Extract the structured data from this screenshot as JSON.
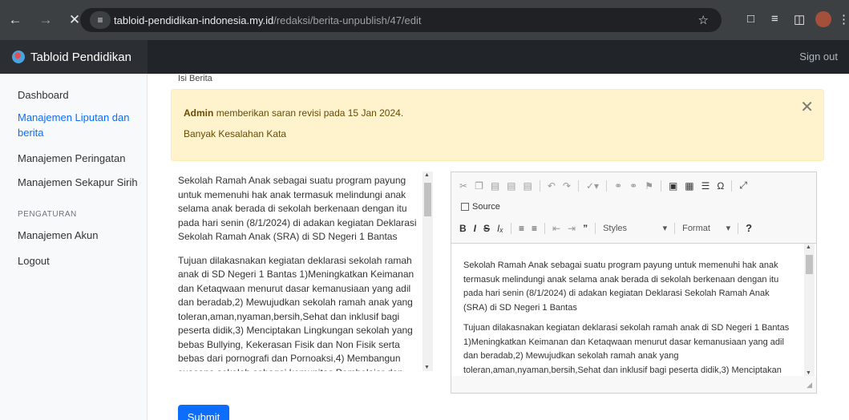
{
  "browser": {
    "url_host": "tabloid-pendidikan-indonesia.my.id",
    "url_path": "/redaksi/berita-unpublish/47/edit"
  },
  "navbar": {
    "brand": "Tabloid Pendidikan",
    "sign_out": "Sign out"
  },
  "sidebar": {
    "items": [
      {
        "label": "Dashboard"
      },
      {
        "label": "Manajemen Liputan dan berita"
      },
      {
        "label": "Manajemen Peringatan"
      },
      {
        "label": "Manajemen Sekapur Sirih"
      }
    ],
    "section_heading": "PENGATURAN",
    "settings_items": [
      {
        "label": "Manajemen Akun"
      },
      {
        "label": "Logout"
      }
    ]
  },
  "form": {
    "field_label": "Isi Berita",
    "alert": {
      "author": "Admin",
      "message": "memberikan saran revisi pada 15 Jan 2024.",
      "note": "Banyak Kesalahan Kata"
    },
    "textarea": {
      "paragraph1": "Sekolah Ramah Anak sebagai suatu program payung untuk memenuhi hak anak termasuk melindungi anak selama anak berada di sekolah berkenaan dengan itu pada hari senin (8/1/2024) di adakan kegiatan Deklarasi Sekolah Ramah Anak (SRA) di SD Negeri 1 Bantas",
      "paragraph2": "Tujuan dilakasnakan kegiatan deklarasi sekolah ramah anak di SD Negeri 1 Bantas 1)Meningkatkan Keimanan dan Ketaqwaan menurut dasar kemanusiaan yang adil dan beradab,2) Mewujudkan sekolah ramah anak yang toleran,aman,nyaman,bersih,Sehat dan inklusif bagi peserta didik,3) Menciptakan Lingkungan sekolah yang bebas Bullying, Kekerasan Fisik dan Non Fisik serta bebas dari pornografi dan Pornoaksi,4) Membangun suasana sekolah sebagai komunitas Pembelajar dan tempat pendidik setelah"
    },
    "editor": {
      "source_label": "Source",
      "styles_label": "Styles",
      "format_label": "Format",
      "paragraph1": "Sekolah Ramah Anak sebagai suatu program payung untuk memenuhi hak anak termasuk melindungi anak selama anak berada di sekolah berkenaan dengan itu pada hari senin (8/1/2024) di adakan kegiatan Deklarasi Sekolah Ramah Anak (SRA) di SD Negeri 1 Bantas",
      "paragraph2": "Tujuan dilakasnakan kegiatan deklarasi sekolah ramah anak di SD Negeri 1 Bantas 1)Meningkatkan Keimanan dan Ketaqwaan menurut dasar kemanusiaan yang adil dan beradab,2) Mewujudkan sekolah ramah anak yang toleran,aman,nyaman,bersih,Sehat dan inklusif bagi peserta didik,3) Menciptakan"
    },
    "submit_label": "Submit"
  },
  "colors": {
    "chrome": "#3c4043",
    "navbar": "#212529",
    "accent": "#0d6efd",
    "alert_bg": "#fff3cd"
  }
}
